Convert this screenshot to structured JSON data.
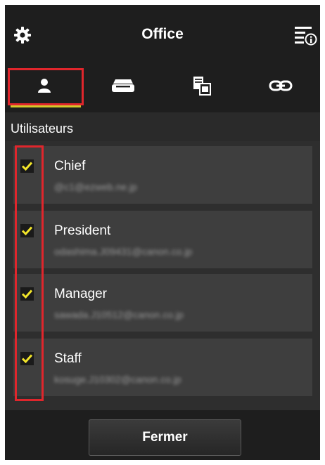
{
  "header": {
    "title": "Office",
    "settings_icon": "gear-icon",
    "info_icon": "menu-info-icon"
  },
  "tabs": [
    {
      "icon": "user-icon",
      "selected": true
    },
    {
      "icon": "printer-icon",
      "selected": false
    },
    {
      "icon": "copy-document-icon",
      "selected": false
    },
    {
      "icon": "link-icon",
      "selected": false
    }
  ],
  "section": {
    "label": "Utilisateurs"
  },
  "users": [
    {
      "name": "Chief",
      "email": "@c1@ezweb.ne.jp",
      "checked": true
    },
    {
      "name": "President",
      "email": "odashima.J09431@canon.co.jp",
      "checked": true
    },
    {
      "name": "Manager",
      "email": "sawada.J10512@canon.co.jp",
      "checked": true
    },
    {
      "name": "Staff",
      "email": "kosuge.J10302@canon.co.jp",
      "checked": true
    }
  ],
  "footer": {
    "close_label": "Fermer"
  },
  "colors": {
    "accent_underline": "#d4c82a",
    "checkmark": "#f2e52a",
    "annotation_highlight": "#e0262c",
    "background": "#2a2a2a"
  }
}
